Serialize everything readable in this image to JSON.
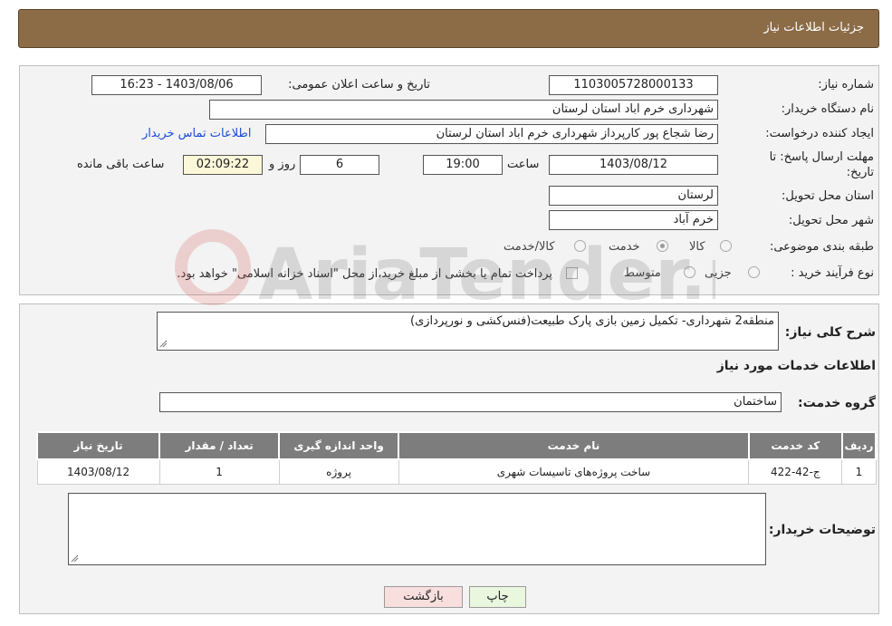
{
  "header": {
    "title": "جزئیات اطلاعات نیاز"
  },
  "form": {
    "need_number_label": "شماره نیاز:",
    "need_number": "1103005728000133",
    "announce_label": "تاریخ و ساعت اعلان عمومی:",
    "announce_value": "1403/08/06 - 16:23",
    "buyer_org_label": "نام دستگاه خریدار:",
    "buyer_org": "شهرداری خرم اباد استان لرستان",
    "creator_label": "ایجاد کننده درخواست:",
    "creator": "رضا شجاع پور کارپرداز شهرداری خرم اباد استان لرستان",
    "contact_link": "اطلاعات تماس خریدار",
    "deadline_label_line1": "مهلت ارسال پاسخ: تا",
    "deadline_label_line2": "تاریخ:",
    "deadline_date": "1403/08/12",
    "time_label": "ساعت",
    "deadline_time": "19:00",
    "days_value": "6",
    "days_label": "روز و",
    "remaining_time": "02:09:22",
    "remaining_label": "ساعت باقی مانده",
    "province_label": "استان محل تحویل:",
    "province": "لرستان",
    "city_label": "شهر محل تحویل:",
    "city": "خرم آباد",
    "category_label": "طبقه بندی موضوعی:",
    "category_options": [
      "کالا",
      "خدمت",
      "کالا/خدمت"
    ],
    "category_selected": "خدمت",
    "process_label": "نوع فرآیند خرید :",
    "process_options": [
      "جزیی",
      "متوسط"
    ],
    "payment_note": "پرداخت تمام یا بخشی از مبلغ خرید،از محل \"اسناد خزانه اسلامی\" خواهد بود."
  },
  "details": {
    "summary_label": "شرح کلی نیاز:",
    "summary": "منطقه2 شهرداری- تکمیل زمین بازی پارک طبیعت(فنس‌کشی و نورپردازی)",
    "services_heading": "اطلاعات خدمات مورد نیاز",
    "service_group_label": "گروه خدمت:",
    "service_group": "ساختمان",
    "table": {
      "headers": [
        "ردیف",
        "کد خدمت",
        "نام خدمت",
        "واحد اندازه گیری",
        "تعداد / مقدار",
        "تاریخ نیاز"
      ],
      "rows": [
        [
          "1",
          "ج-42-422",
          "ساخت پروژه‌های تاسیسات شهری",
          "پروژه",
          "1",
          "1403/08/12"
        ]
      ]
    },
    "buyer_notes_label": "توضیحات خریدار:",
    "buyer_notes": ""
  },
  "buttons": {
    "print": "چاپ",
    "back": "بازگشت"
  },
  "watermark": {
    "text": "AriaTender.net"
  },
  "colors": {
    "header_bg": "#8b6c47",
    "table_header_bg": "#7d7d7d",
    "link": "#1a4fd6",
    "back_btn": "#f9dede",
    "print_btn": "#e9f7df"
  }
}
